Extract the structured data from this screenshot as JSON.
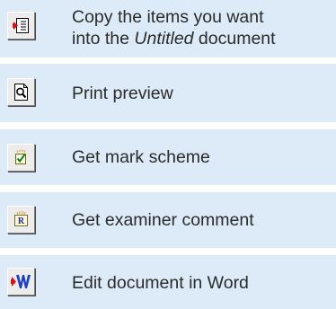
{
  "items": [
    {
      "icon": "copy-to-document-icon",
      "label_line1": "Copy the items you want",
      "label_line2_prefix": "into the ",
      "label_line2_emphasis": "Untitled",
      "label_line2_suffix": " document"
    },
    {
      "icon": "print-preview-icon",
      "label": "Print preview"
    },
    {
      "icon": "mark-scheme-icon",
      "label": "Get mark scheme"
    },
    {
      "icon": "examiner-comment-icon",
      "label": "Get examiner comment"
    },
    {
      "icon": "word-document-icon",
      "label": "Edit document in Word"
    }
  ],
  "colors": {
    "row_background": "#dcebf7",
    "text": "#2b2b2b",
    "button_face": "#ececec"
  }
}
